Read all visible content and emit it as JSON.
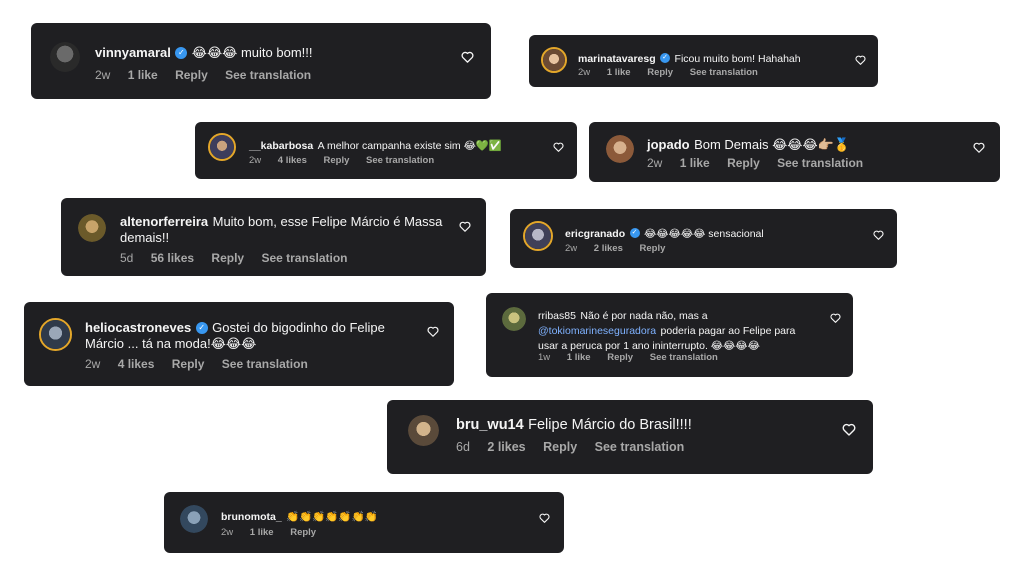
{
  "comments": [
    {
      "username": "vinnyamaral",
      "verified": true,
      "text": "😂😂😂 muito bom!!!",
      "time": "2w",
      "likes": "1 like",
      "reply": "Reply",
      "translate": "See translation"
    },
    {
      "username": "marinatavaresg",
      "verified": true,
      "text": "Ficou muito bom! Hahahah",
      "time": "2w",
      "likes": "1 like",
      "reply": "Reply",
      "translate": "See translation"
    },
    {
      "username": "__kabarbosa",
      "verified": false,
      "text": "A melhor campanha existe sim 😂💚✅",
      "time": "2w",
      "likes": "4 likes",
      "reply": "Reply",
      "translate": "See translation"
    },
    {
      "username": "jopado",
      "verified": false,
      "text": "Bom Demais 😂😂😂👉🏼🥇",
      "time": "2w",
      "likes": "1 like",
      "reply": "Reply",
      "translate": "See translation"
    },
    {
      "username": "altenorferreira",
      "verified": false,
      "text": "Muito bom, esse Felipe Márcio é Massa demais!!",
      "time": "5d",
      "likes": "56 likes",
      "reply": "Reply",
      "translate": "See translation"
    },
    {
      "username": "ericgranado",
      "verified": true,
      "text": "😂😂😂😂😂 sensacional",
      "time": "2w",
      "likes": "2 likes",
      "reply": "Reply",
      "translate": ""
    },
    {
      "username": "heliocastroneves",
      "verified": true,
      "text": "Gostei do bigodinho do Felipe Márcio ... tá na moda!😂😂😂",
      "time": "2w",
      "likes": "4 likes",
      "reply": "Reply",
      "translate": "See translation"
    },
    {
      "username": "rribas85",
      "verified": false,
      "text_before": "Não é por nada não, mas a",
      "mention": "@tokiomarineseguradora",
      "text_after": "poderia pagar ao Felipe para usar a peruca por 1 ano ininterrupto. 😂😂😂😂",
      "time": "1w",
      "likes": "1 like",
      "reply": "Reply",
      "translate": "See translation"
    },
    {
      "username": "bru_wu14",
      "verified": false,
      "text": "Felipe Márcio do Brasil!!!!",
      "time": "6d",
      "likes": "2 likes",
      "reply": "Reply",
      "translate": "See translation"
    },
    {
      "username": "brunomota_",
      "verified": false,
      "text": "👏👏👏👏👏👏👏",
      "time": "2w",
      "likes": "1 like",
      "reply": "Reply",
      "translate": ""
    }
  ],
  "icons": {
    "heart": "heart-outline-icon",
    "verified": "verified-badge-icon"
  },
  "colors": {
    "card_bg": "#1f1f22",
    "meta_text": "#a8a8a8",
    "verified_blue": "#3897f0",
    "mention": "#7fb2ff",
    "story_ring": "#e4a72a"
  }
}
